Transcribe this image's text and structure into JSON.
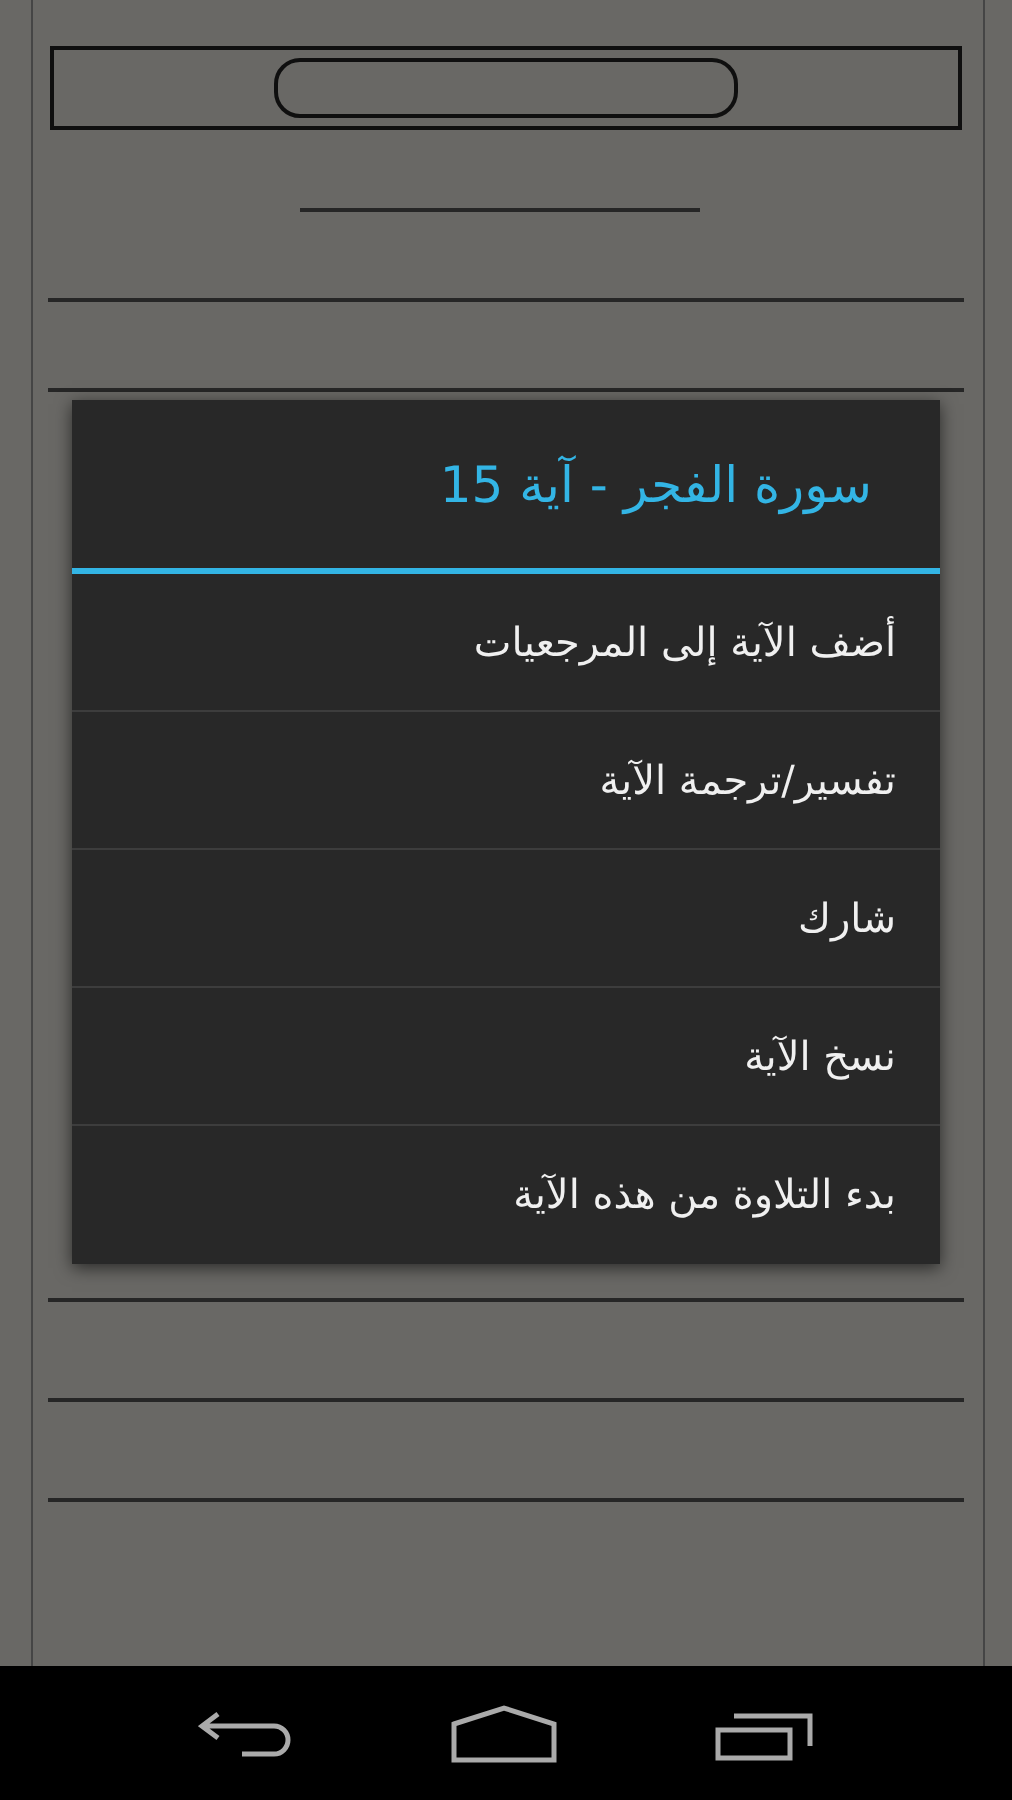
{
  "dialog": {
    "title": "سورة الفجر - آية 15",
    "items": [
      {
        "label": "أضف الآية إلى المرجعيات"
      },
      {
        "label": "تفسير/ترجمة الآية"
      },
      {
        "label": "شارك"
      },
      {
        "label": "نسخ الآية"
      },
      {
        "label": "بدء التلاوة من هذه الآية"
      }
    ]
  }
}
